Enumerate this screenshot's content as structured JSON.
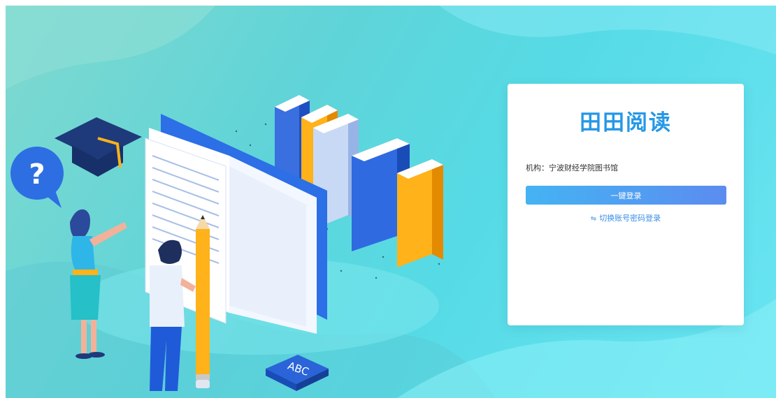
{
  "login": {
    "brand_title": "田田阅读",
    "org_text": "机构：宁波财经学院图书馆",
    "one_click_label": "一键登录",
    "switch_icon": "⇋",
    "switch_label": "切换账号密码登录"
  },
  "illustration": {
    "block_label": "ABC",
    "bubble_text": "?"
  },
  "colors": {
    "brand": "#2598e6",
    "button_start": "#45b3f3",
    "button_end": "#5b8cf0",
    "link": "#3a8ee6"
  }
}
